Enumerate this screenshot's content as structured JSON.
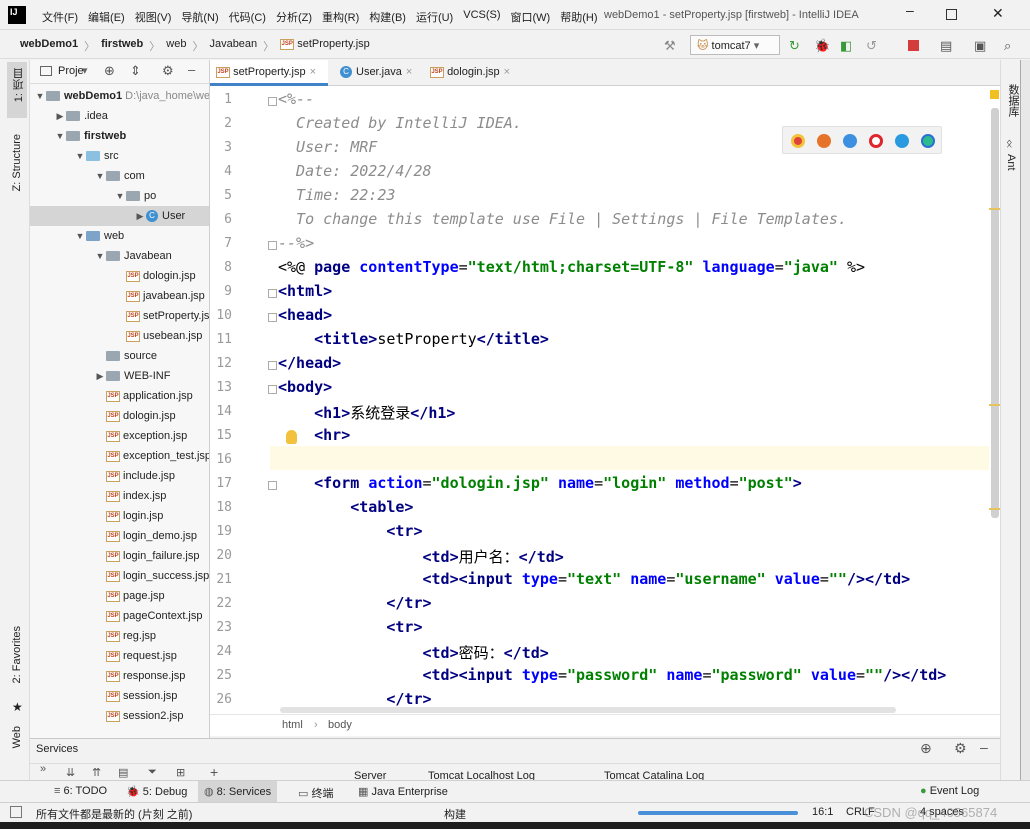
{
  "menubar": {
    "logo": "IJ",
    "items": [
      "文件(F)",
      "编辑(E)",
      "视图(V)",
      "导航(N)",
      "代码(C)",
      "分析(Z)",
      "重构(R)",
      "构建(B)",
      "运行(U)",
      "VCS(S)",
      "窗口(W)",
      "帮助(H)"
    ],
    "window_title": "webDemo1 - setProperty.jsp [firstweb] - IntelliJ IDEA"
  },
  "navbar": {
    "crumbs": [
      "webDemo1",
      "firstweb",
      "web",
      "Javabean",
      "setProperty.jsp"
    ],
    "run_config": "tomcat7"
  },
  "left_stripe": {
    "project": "1: 项目",
    "structure": "Z: Structure",
    "favorites": "2: Favorites",
    "web": "Web"
  },
  "right_stripe": {
    "database": "数据库",
    "ant": "Ant"
  },
  "project_panel": {
    "title": "Proje",
    "tree": [
      {
        "label": "webDemo1",
        "hint": "D:\\java_home\\we",
        "indent": 0,
        "arrow": "▼",
        "icon": "folder",
        "bold": true
      },
      {
        "label": ".idea",
        "indent": 1,
        "arrow": "▶",
        "icon": "folder"
      },
      {
        "label": "firstweb",
        "indent": 1,
        "arrow": "▼",
        "icon": "folder",
        "bold": true
      },
      {
        "label": "src",
        "indent": 2,
        "arrow": "▼",
        "icon": "src"
      },
      {
        "label": "com",
        "indent": 3,
        "arrow": "▼",
        "icon": "folder"
      },
      {
        "label": "po",
        "indent": 4,
        "arrow": "▼",
        "icon": "folder"
      },
      {
        "label": "User",
        "indent": 5,
        "arrow": "▶",
        "icon": "class",
        "selected": true
      },
      {
        "label": "web",
        "indent": 2,
        "arrow": "▼",
        "icon": "web"
      },
      {
        "label": "Javabean",
        "indent": 3,
        "arrow": "▼",
        "icon": "folder"
      },
      {
        "label": "dologin.jsp",
        "indent": 4,
        "arrow": "",
        "icon": "jsp"
      },
      {
        "label": "javabean.jsp",
        "indent": 4,
        "arrow": "",
        "icon": "jsp"
      },
      {
        "label": "setProperty.jsp",
        "indent": 4,
        "arrow": "",
        "icon": "jsp"
      },
      {
        "label": "usebean.jsp",
        "indent": 4,
        "arrow": "",
        "icon": "jsp"
      },
      {
        "label": "source",
        "indent": 3,
        "arrow": "",
        "icon": "folder"
      },
      {
        "label": "WEB-INF",
        "indent": 3,
        "arrow": "▶",
        "icon": "folder"
      },
      {
        "label": "application.jsp",
        "indent": 3,
        "arrow": "",
        "icon": "jsp"
      },
      {
        "label": "dologin.jsp",
        "indent": 3,
        "arrow": "",
        "icon": "jsp"
      },
      {
        "label": "exception.jsp",
        "indent": 3,
        "arrow": "",
        "icon": "jsp"
      },
      {
        "label": "exception_test.jsp",
        "indent": 3,
        "arrow": "",
        "icon": "jsp"
      },
      {
        "label": "include.jsp",
        "indent": 3,
        "arrow": "",
        "icon": "jsp"
      },
      {
        "label": "index.jsp",
        "indent": 3,
        "arrow": "",
        "icon": "jsp"
      },
      {
        "label": "login.jsp",
        "indent": 3,
        "arrow": "",
        "icon": "jsp"
      },
      {
        "label": "login_demo.jsp",
        "indent": 3,
        "arrow": "",
        "icon": "jsp"
      },
      {
        "label": "login_failure.jsp",
        "indent": 3,
        "arrow": "",
        "icon": "jsp"
      },
      {
        "label": "login_success.jsp",
        "indent": 3,
        "arrow": "",
        "icon": "jsp"
      },
      {
        "label": "page.jsp",
        "indent": 3,
        "arrow": "",
        "icon": "jsp"
      },
      {
        "label": "pageContext.jsp",
        "indent": 3,
        "arrow": "",
        "icon": "jsp"
      },
      {
        "label": "reg.jsp",
        "indent": 3,
        "arrow": "",
        "icon": "jsp"
      },
      {
        "label": "request.jsp",
        "indent": 3,
        "arrow": "",
        "icon": "jsp"
      },
      {
        "label": "response.jsp",
        "indent": 3,
        "arrow": "",
        "icon": "jsp"
      },
      {
        "label": "session.jsp",
        "indent": 3,
        "arrow": "",
        "icon": "jsp"
      },
      {
        "label": "session2.jsp",
        "indent": 3,
        "arrow": "",
        "icon": "jsp"
      }
    ]
  },
  "tabs": [
    {
      "label": "setProperty.jsp",
      "icon": "jsp",
      "active": true
    },
    {
      "label": "User.java",
      "icon": "class",
      "active": false
    },
    {
      "label": "dologin.jsp",
      "icon": "jsp",
      "active": false
    }
  ],
  "editor": {
    "lines": [
      [
        [
          "cmt",
          "<%--"
        ]
      ],
      [
        [
          "cmt",
          "  Created by IntelliJ IDEA."
        ]
      ],
      [
        [
          "cmt",
          "  User: MRF"
        ]
      ],
      [
        [
          "cmt",
          "  Date: 2022/4/28"
        ]
      ],
      [
        [
          "cmt",
          "  Time: 22:23"
        ]
      ],
      [
        [
          "cmt",
          "  To change this template use File | Settings | File Templates."
        ]
      ],
      [
        [
          "cmt",
          "--%>"
        ]
      ],
      [
        [
          "dir",
          "<%@ "
        ],
        [
          "tag",
          "page "
        ],
        [
          "attr",
          "contentType"
        ],
        [
          "dir",
          "="
        ],
        [
          "str",
          "\"text/html;charset=UTF-8\""
        ],
        [
          "dir",
          " "
        ],
        [
          "attr",
          "language"
        ],
        [
          "dir",
          "="
        ],
        [
          "str",
          "\"java\""
        ],
        [
          "dir",
          " %>"
        ]
      ],
      [
        [
          "tag",
          "<html>"
        ]
      ],
      [
        [
          "tag",
          "<head>"
        ]
      ],
      [
        [
          "dir",
          "    "
        ],
        [
          "tag",
          "<title>"
        ],
        [
          "dir",
          "setProperty"
        ],
        [
          "tag",
          "</title>"
        ]
      ],
      [
        [
          "tag",
          "</head>"
        ]
      ],
      [
        [
          "tag",
          "<body>"
        ]
      ],
      [
        [
          "dir",
          "    "
        ],
        [
          "tag",
          "<h1>"
        ],
        [
          "dir",
          "系统登录"
        ],
        [
          "tag",
          "</h1>"
        ]
      ],
      [
        [
          "dir",
          "    "
        ],
        [
          "tag",
          "<hr>"
        ]
      ],
      [
        [
          "dir",
          ""
        ]
      ],
      [
        [
          "dir",
          "    "
        ],
        [
          "tag",
          "<form "
        ],
        [
          "attr",
          "action"
        ],
        [
          "dir",
          "="
        ],
        [
          "str",
          "\"dologin.jsp\""
        ],
        [
          "dir",
          " "
        ],
        [
          "attr",
          "name"
        ],
        [
          "dir",
          "="
        ],
        [
          "str",
          "\"login\""
        ],
        [
          "dir",
          " "
        ],
        [
          "attr",
          "method"
        ],
        [
          "dir",
          "="
        ],
        [
          "str",
          "\"post\""
        ],
        [
          "tag",
          ">"
        ]
      ],
      [
        [
          "dir",
          "        "
        ],
        [
          "tag",
          "<table>"
        ]
      ],
      [
        [
          "dir",
          "            "
        ],
        [
          "tag",
          "<tr>"
        ]
      ],
      [
        [
          "dir",
          "                "
        ],
        [
          "tag",
          "<td>"
        ],
        [
          "dir",
          "用户名："
        ],
        [
          "tag",
          "</td>"
        ]
      ],
      [
        [
          "dir",
          "                "
        ],
        [
          "tag",
          "<td><input "
        ],
        [
          "attr",
          "type"
        ],
        [
          "dir",
          "="
        ],
        [
          "str",
          "\"text\""
        ],
        [
          "dir",
          " "
        ],
        [
          "attr",
          "name"
        ],
        [
          "dir",
          "="
        ],
        [
          "str",
          "\"username\""
        ],
        [
          "dir",
          " "
        ],
        [
          "attr",
          "value"
        ],
        [
          "dir",
          "="
        ],
        [
          "str",
          "\"\""
        ],
        [
          "tag",
          "/></td>"
        ]
      ],
      [
        [
          "dir",
          "            "
        ],
        [
          "tag",
          "</tr>"
        ]
      ],
      [
        [
          "dir",
          "            "
        ],
        [
          "tag",
          "<tr>"
        ]
      ],
      [
        [
          "dir",
          "                "
        ],
        [
          "tag",
          "<td>"
        ],
        [
          "dir",
          "密码："
        ],
        [
          "tag",
          "</td>"
        ]
      ],
      [
        [
          "dir",
          "                "
        ],
        [
          "tag",
          "<td><input "
        ],
        [
          "attr",
          "type"
        ],
        [
          "dir",
          "="
        ],
        [
          "str",
          "\"password\""
        ],
        [
          "dir",
          " "
        ],
        [
          "attr",
          "name"
        ],
        [
          "dir",
          "="
        ],
        [
          "str",
          "\"password\""
        ],
        [
          "dir",
          " "
        ],
        [
          "attr",
          "value"
        ],
        [
          "dir",
          "="
        ],
        [
          "str",
          "\"\""
        ],
        [
          "tag",
          "/></td>"
        ]
      ],
      [
        [
          "dir",
          "            "
        ],
        [
          "tag",
          "</tr>"
        ]
      ]
    ],
    "breadcrumb": [
      "html",
      "body"
    ]
  },
  "services": {
    "title": "Services",
    "tabs": [
      "Server",
      "Tomcat Localhost Log",
      "Tomcat Catalina Log"
    ]
  },
  "tool_tabs": {
    "todo": "6: TODO",
    "debug": "5: Debug",
    "services": "8: Services",
    "terminal": "终端",
    "java_enterprise": "Java Enterprise",
    "event_log": "Event Log"
  },
  "status": {
    "message": "所有文件都是最新的 (片刻 之前)",
    "build": "构建",
    "position": "16:1",
    "line_sep": "CRLF",
    "indent": "4 spaces",
    "watermark": "CSDN @qq_40565874"
  },
  "colors": {
    "accent": "#4083c9",
    "current_line": "#fffae3",
    "selection": "#d5d5d5"
  }
}
